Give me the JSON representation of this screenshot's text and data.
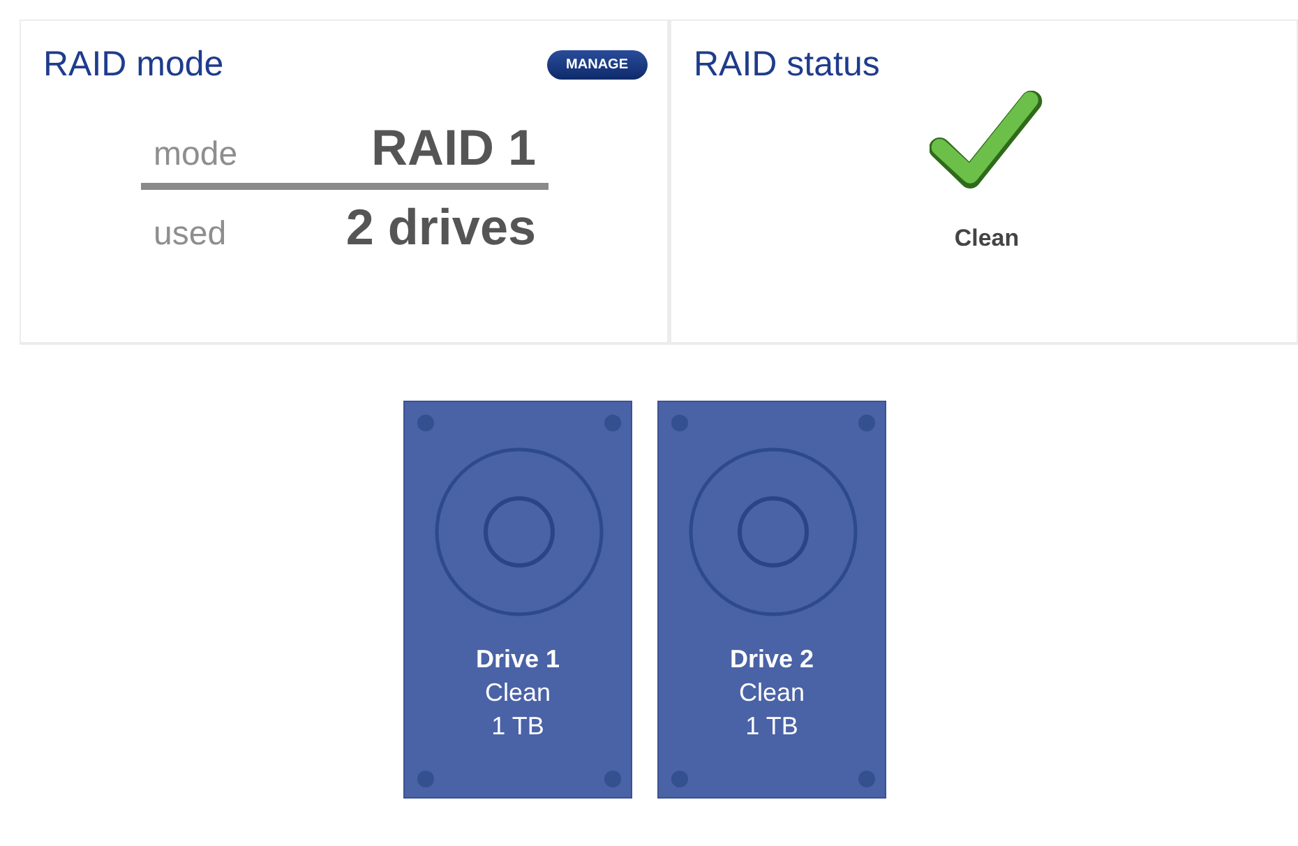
{
  "raid_mode": {
    "title": "RAID mode",
    "manage_button": "MANAGE",
    "rows": [
      {
        "label": "mode",
        "value": "RAID 1"
      },
      {
        "label": "used",
        "value": "2 drives"
      }
    ]
  },
  "raid_status": {
    "title": "RAID status",
    "kind": "clean",
    "label": "Clean"
  },
  "drives": [
    {
      "name": "Drive 1",
      "status": "Clean",
      "size": "1 TB"
    },
    {
      "name": "Drive 2",
      "status": "Clean",
      "size": "1 TB"
    }
  ]
}
